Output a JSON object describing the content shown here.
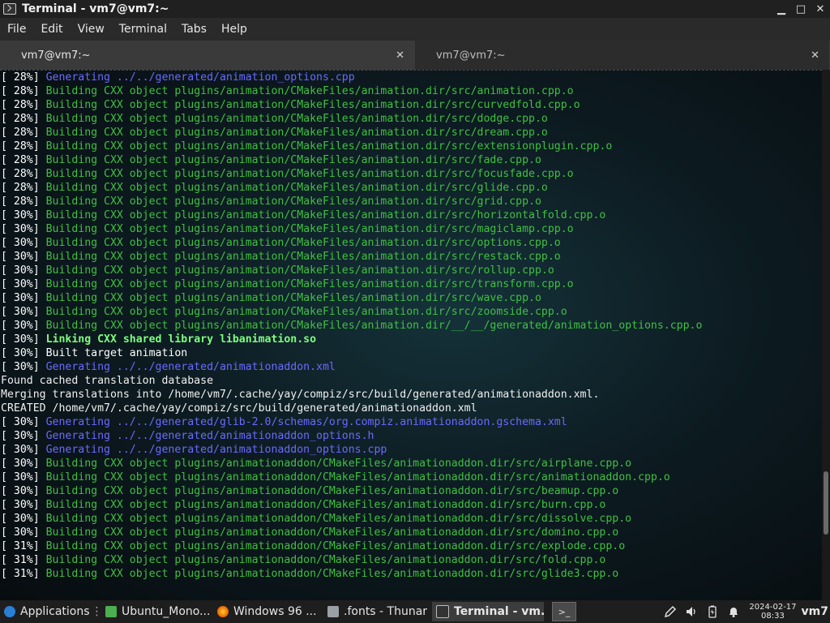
{
  "window": {
    "title": "Terminal - vm7@vm7:~",
    "minimize": "▁",
    "maximize": "□",
    "close": "✕"
  },
  "menu": [
    "File",
    "Edit",
    "View",
    "Terminal",
    "Tabs",
    "Help"
  ],
  "tabs": [
    {
      "label": "vm7@vm7:~",
      "close": "✕",
      "active": true
    },
    {
      "label": "vm7@vm7:~",
      "close": "✕",
      "active": false
    }
  ],
  "terminal_lines": [
    {
      "pct": "[ 28%] ",
      "text": "Generating ../../generated/animation_options.cpp",
      "color": "blue"
    },
    {
      "pct": "[ 28%] ",
      "text": "Building CXX object plugins/animation/CMakeFiles/animation.dir/src/animation.cpp.o",
      "color": "green"
    },
    {
      "pct": "[ 28%] ",
      "text": "Building CXX object plugins/animation/CMakeFiles/animation.dir/src/curvedfold.cpp.o",
      "color": "green"
    },
    {
      "pct": "[ 28%] ",
      "text": "Building CXX object plugins/animation/CMakeFiles/animation.dir/src/dodge.cpp.o",
      "color": "green"
    },
    {
      "pct": "[ 28%] ",
      "text": "Building CXX object plugins/animation/CMakeFiles/animation.dir/src/dream.cpp.o",
      "color": "green"
    },
    {
      "pct": "[ 28%] ",
      "text": "Building CXX object plugins/animation/CMakeFiles/animation.dir/src/extensionplugin.cpp.o",
      "color": "green"
    },
    {
      "pct": "[ 28%] ",
      "text": "Building CXX object plugins/animation/CMakeFiles/animation.dir/src/fade.cpp.o",
      "color": "green"
    },
    {
      "pct": "[ 28%] ",
      "text": "Building CXX object plugins/animation/CMakeFiles/animation.dir/src/focusfade.cpp.o",
      "color": "green"
    },
    {
      "pct": "[ 28%] ",
      "text": "Building CXX object plugins/animation/CMakeFiles/animation.dir/src/glide.cpp.o",
      "color": "green"
    },
    {
      "pct": "[ 28%] ",
      "text": "Building CXX object plugins/animation/CMakeFiles/animation.dir/src/grid.cpp.o",
      "color": "green"
    },
    {
      "pct": "[ 30%] ",
      "text": "Building CXX object plugins/animation/CMakeFiles/animation.dir/src/horizontalfold.cpp.o",
      "color": "green"
    },
    {
      "pct": "[ 30%] ",
      "text": "Building CXX object plugins/animation/CMakeFiles/animation.dir/src/magiclamp.cpp.o",
      "color": "green"
    },
    {
      "pct": "[ 30%] ",
      "text": "Building CXX object plugins/animation/CMakeFiles/animation.dir/src/options.cpp.o",
      "color": "green"
    },
    {
      "pct": "[ 30%] ",
      "text": "Building CXX object plugins/animation/CMakeFiles/animation.dir/src/restack.cpp.o",
      "color": "green"
    },
    {
      "pct": "[ 30%] ",
      "text": "Building CXX object plugins/animation/CMakeFiles/animation.dir/src/rollup.cpp.o",
      "color": "green"
    },
    {
      "pct": "[ 30%] ",
      "text": "Building CXX object plugins/animation/CMakeFiles/animation.dir/src/transform.cpp.o",
      "color": "green"
    },
    {
      "pct": "[ 30%] ",
      "text": "Building CXX object plugins/animation/CMakeFiles/animation.dir/src/wave.cpp.o",
      "color": "green"
    },
    {
      "pct": "[ 30%] ",
      "text": "Building CXX object plugins/animation/CMakeFiles/animation.dir/src/zoomside.cpp.o",
      "color": "green"
    },
    {
      "pct": "[ 30%] ",
      "text": "Building CXX object plugins/animation/CMakeFiles/animation.dir/__/__/generated/animation_options.cpp.o",
      "color": "green"
    },
    {
      "pct": "[ 30%] ",
      "text": "Linking CXX shared library libanimation.so",
      "color": "bgreen"
    },
    {
      "pct": "[ 30%] ",
      "text": "Built target animation",
      "color": "white"
    },
    {
      "pct": "[ 30%] ",
      "text": "Generating ../../generated/animationaddon.xml",
      "color": "blue"
    },
    {
      "pct": "",
      "text": "Found cached translation database",
      "color": "plain"
    },
    {
      "pct": "",
      "text": "Merging translations into /home/vm7/.cache/yay/compiz/src/build/generated/animationaddon.xml.",
      "color": "plain"
    },
    {
      "pct": "",
      "text": "CREATED /home/vm7/.cache/yay/compiz/src/build/generated/animationaddon.xml",
      "color": "plain"
    },
    {
      "pct": "[ 30%] ",
      "text": "Generating ../../generated/glib-2.0/schemas/org.compiz.animationaddon.gschema.xml",
      "color": "blue"
    },
    {
      "pct": "[ 30%] ",
      "text": "Generating ../../generated/animationaddon_options.h",
      "color": "blue"
    },
    {
      "pct": "[ 30%] ",
      "text": "Generating ../../generated/animationaddon_options.cpp",
      "color": "blue"
    },
    {
      "pct": "[ 30%] ",
      "text": "Building CXX object plugins/animationaddon/CMakeFiles/animationaddon.dir/src/airplane.cpp.o",
      "color": "green"
    },
    {
      "pct": "[ 30%] ",
      "text": "Building CXX object plugins/animationaddon/CMakeFiles/animationaddon.dir/src/animationaddon.cpp.o",
      "color": "green"
    },
    {
      "pct": "[ 30%] ",
      "text": "Building CXX object plugins/animationaddon/CMakeFiles/animationaddon.dir/src/beamup.cpp.o",
      "color": "green"
    },
    {
      "pct": "[ 30%] ",
      "text": "Building CXX object plugins/animationaddon/CMakeFiles/animationaddon.dir/src/burn.cpp.o",
      "color": "green"
    },
    {
      "pct": "[ 30%] ",
      "text": "Building CXX object plugins/animationaddon/CMakeFiles/animationaddon.dir/src/dissolve.cpp.o",
      "color": "green"
    },
    {
      "pct": "[ 30%] ",
      "text": "Building CXX object plugins/animationaddon/CMakeFiles/animationaddon.dir/src/domino.cpp.o",
      "color": "green"
    },
    {
      "pct": "[ 31%] ",
      "text": "Building CXX object plugins/animationaddon/CMakeFiles/animationaddon.dir/src/explode.cpp.o",
      "color": "green"
    },
    {
      "pct": "[ 31%] ",
      "text": "Building CXX object plugins/animationaddon/CMakeFiles/animationaddon.dir/src/fold.cpp.o",
      "color": "green"
    },
    {
      "pct": "[ 31%] ",
      "text": "Building CXX object plugins/animationaddon/CMakeFiles/animationaddon.dir/src/glide3.cpp.o",
      "color": "green"
    }
  ],
  "scrollbar": {
    "position_fraction": 0.86,
    "visible_fraction": 0.12
  },
  "taskbar": {
    "applications": "Applications",
    "applications_sep": "⋮",
    "windows": [
      {
        "label": "Ubuntu_Mono...",
        "icon": "ubuntu-mono-icon",
        "color": "#4caf50"
      },
      {
        "label": "Windows 96 ...",
        "icon": "firefox-icon",
        "color": "#e66000"
      },
      {
        "label": ".fonts - Thunar",
        "icon": "folder-icon",
        "color": "#9aa0a6"
      },
      {
        "label": "Terminal - vm...",
        "icon": "terminal-icon",
        "color": "#333333",
        "active": true
      }
    ],
    "launcher": ">_",
    "clock_date": "2024-02-17",
    "clock_time": "08:33",
    "user": "vm7"
  },
  "colors": {
    "green": "#40c040",
    "blue": "#6a6aff",
    "bgreen": "#7dff7d",
    "white": "#ffffff",
    "plain": "#f0f0f0"
  }
}
